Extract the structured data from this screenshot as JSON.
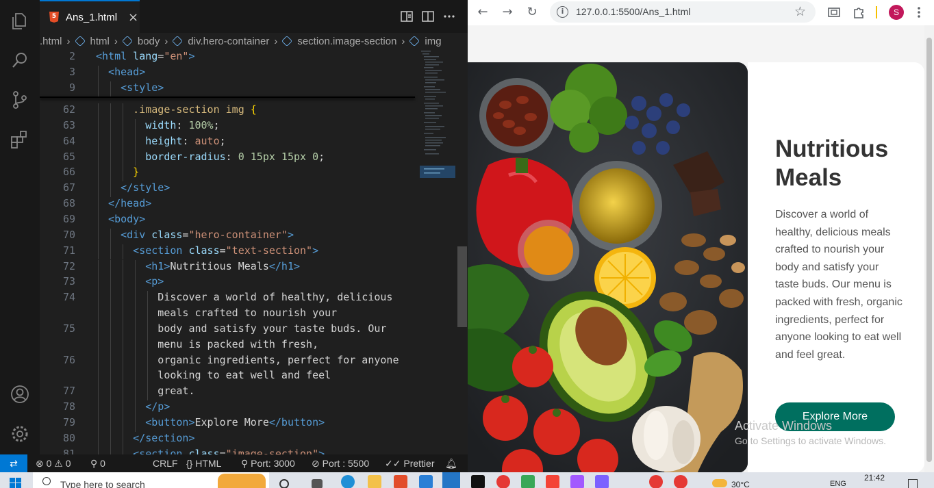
{
  "vscode": {
    "tab": {
      "filename": "Ans_1.html",
      "close": "×"
    },
    "breadcrumb": [
      ".html",
      "html",
      "body",
      "div.hero-container",
      "section.image-section",
      "img"
    ],
    "sticky_lines": [
      {
        "num": "2",
        "indent": 0,
        "tokens": [
          [
            "tag",
            "<html"
          ],
          [
            "attr",
            " lang"
          ],
          [
            "plain",
            "="
          ],
          [
            "str",
            "\"en\""
          ],
          [
            "tag",
            ">"
          ]
        ]
      },
      {
        "num": "3",
        "indent": 1,
        "tokens": [
          [
            "tag",
            "<head>"
          ]
        ]
      },
      {
        "num": "9",
        "indent": 2,
        "tokens": [
          [
            "tag",
            "<style>"
          ]
        ]
      }
    ],
    "lines": [
      {
        "num": "62",
        "indent": 3,
        "tokens": [
          [
            "sel",
            ".image-section img "
          ],
          [
            "brace",
            "{"
          ]
        ]
      },
      {
        "num": "63",
        "indent": 4,
        "tokens": [
          [
            "attr",
            "width"
          ],
          [
            "plain",
            ": "
          ],
          [
            "num",
            "100%"
          ],
          [
            "plain",
            ";"
          ]
        ]
      },
      {
        "num": "64",
        "indent": 4,
        "tokens": [
          [
            "attr",
            "height"
          ],
          [
            "plain",
            ": "
          ],
          [
            "str",
            "auto"
          ],
          [
            "plain",
            ";"
          ]
        ]
      },
      {
        "num": "65",
        "indent": 4,
        "tokens": [
          [
            "attr",
            "border-radius"
          ],
          [
            "plain",
            ": "
          ],
          [
            "num",
            "0 15px 15px 0"
          ],
          [
            "plain",
            ";"
          ]
        ]
      },
      {
        "num": "66",
        "indent": 3,
        "tokens": [
          [
            "brace",
            "}"
          ]
        ]
      },
      {
        "num": "67",
        "indent": 2,
        "tokens": [
          [
            "tag",
            "</style>"
          ]
        ]
      },
      {
        "num": "68",
        "indent": 1,
        "tokens": [
          [
            "tag",
            "</head>"
          ]
        ]
      },
      {
        "num": "69",
        "indent": 1,
        "tokens": [
          [
            "tag",
            "<body>"
          ]
        ]
      },
      {
        "num": "70",
        "indent": 2,
        "tokens": [
          [
            "tag",
            "<div"
          ],
          [
            "attr",
            " class"
          ],
          [
            "plain",
            "="
          ],
          [
            "str",
            "\"hero-container\""
          ],
          [
            "tag",
            ">"
          ]
        ]
      },
      {
        "num": "71",
        "indent": 3,
        "tokens": [
          [
            "tag",
            "<section"
          ],
          [
            "attr",
            " class"
          ],
          [
            "plain",
            "="
          ],
          [
            "str",
            "\"text-section\""
          ],
          [
            "tag",
            ">"
          ]
        ]
      },
      {
        "num": "72",
        "indent": 4,
        "tokens": [
          [
            "tag",
            "<h1>"
          ],
          [
            "plain",
            "Nutritious Meals"
          ],
          [
            "tag",
            "</h1>"
          ]
        ]
      },
      {
        "num": "73",
        "indent": 4,
        "tokens": [
          [
            "tag",
            "<p>"
          ]
        ]
      },
      {
        "num": "74",
        "indent": 5,
        "tokens": [
          [
            "plain",
            "Discover a world of healthy, delicious"
          ]
        ]
      },
      {
        "num": "",
        "indent": 5,
        "tokens": [
          [
            "plain",
            "meals crafted to nourish your"
          ]
        ]
      },
      {
        "num": "75",
        "indent": 5,
        "tokens": [
          [
            "plain",
            "body and satisfy your taste buds. Our"
          ]
        ]
      },
      {
        "num": "",
        "indent": 5,
        "tokens": [
          [
            "plain",
            "menu is packed with fresh,"
          ]
        ]
      },
      {
        "num": "76",
        "indent": 5,
        "tokens": [
          [
            "plain",
            "organic ingredients, perfect for anyone"
          ]
        ]
      },
      {
        "num": "",
        "indent": 5,
        "tokens": [
          [
            "plain",
            "looking to eat well and feel"
          ]
        ]
      },
      {
        "num": "77",
        "indent": 5,
        "tokens": [
          [
            "plain",
            "great."
          ]
        ]
      },
      {
        "num": "78",
        "indent": 4,
        "tokens": [
          [
            "tag",
            "</p>"
          ]
        ]
      },
      {
        "num": "79",
        "indent": 4,
        "tokens": [
          [
            "tag",
            "<button>"
          ],
          [
            "plain",
            "Explore More"
          ],
          [
            "tag",
            "</button>"
          ]
        ]
      },
      {
        "num": "80",
        "indent": 3,
        "tokens": [
          [
            "tag",
            "</section>"
          ]
        ]
      },
      {
        "num": "81",
        "indent": 3,
        "tokens": [
          [
            "tag",
            "<section"
          ],
          [
            "attr",
            " class"
          ],
          [
            "plain",
            "="
          ],
          [
            "str",
            "\"image-section\""
          ],
          [
            "tag",
            ">"
          ]
        ]
      }
    ],
    "status": {
      "errors": "0",
      "warnings": "0",
      "ports": "0",
      "eol": "CRLF",
      "language": "HTML",
      "live_port": "Port: 3000",
      "server_port": "Port : 5500",
      "formatter": "Prettier"
    }
  },
  "browser": {
    "url": "127.0.0.1:5500/Ans_1.html",
    "avatar": "S",
    "hero": {
      "title": "Nutritious Meals",
      "description": "Discover a world of healthy, delicious meals crafted to nourish your body and satisfy your taste buds. Our menu is packed with fresh, organic ingredients, perfect for anyone looking to eat well and feel great.",
      "button": "Explore More"
    },
    "watermark": {
      "line1": "Activate Windows",
      "line2": "Go to Settings to activate Windows."
    },
    "colors": {
      "button": "#006f5f"
    }
  },
  "taskbar": {
    "search_placeholder": "Type here to search",
    "weather": "30°C",
    "language": "ENG",
    "time": "21:42"
  }
}
